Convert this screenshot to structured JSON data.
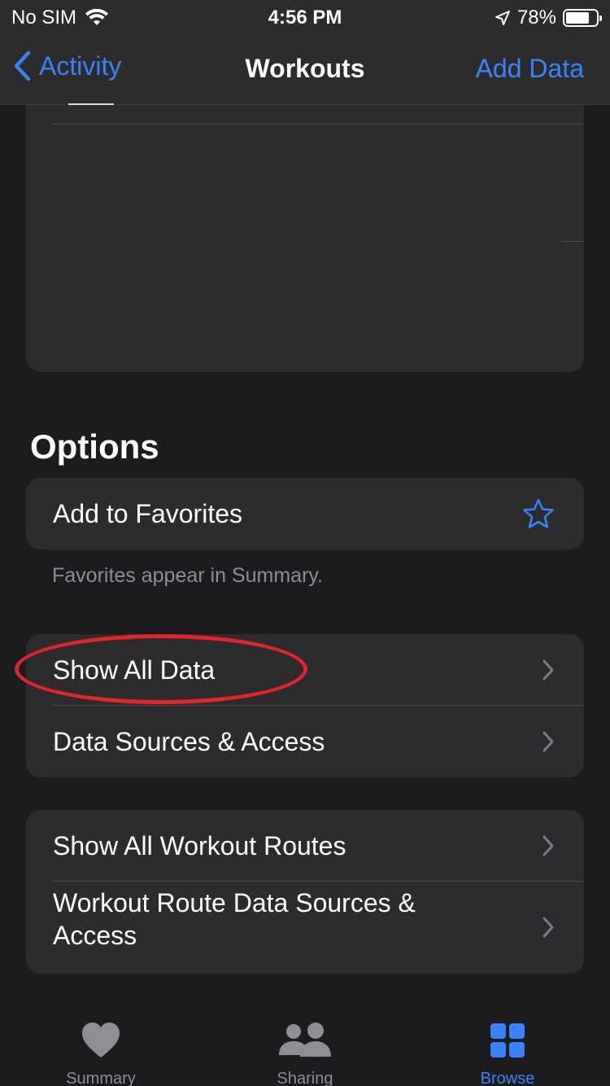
{
  "status_bar": {
    "carrier": "No SIM",
    "time": "4:56 PM",
    "battery": "78%",
    "battery_level": 0.78
  },
  "nav": {
    "back_label": "Activity",
    "title": "Workouts",
    "action_label": "Add Data"
  },
  "options": {
    "title": "Options",
    "favorites_label": "Add to Favorites",
    "favorites_footnote": "Favorites appear in Summary."
  },
  "data_group": {
    "items": [
      {
        "label": "Show All Data"
      },
      {
        "label": "Data Sources & Access"
      }
    ]
  },
  "routes_group": {
    "items": [
      {
        "label": "Show All Workout Routes"
      },
      {
        "label": "Workout Route Data Sources & Access"
      }
    ]
  },
  "tabs": [
    {
      "label": "Summary",
      "icon": "heart-icon",
      "active": false
    },
    {
      "label": "Sharing",
      "icon": "people-icon",
      "active": false
    },
    {
      "label": "Browse",
      "icon": "grid-icon",
      "active": true
    }
  ],
  "colors": {
    "accent": "#3a82f7",
    "background": "#1c1c1e",
    "card": "#2c2c2e",
    "annotation": "#e3242b"
  }
}
